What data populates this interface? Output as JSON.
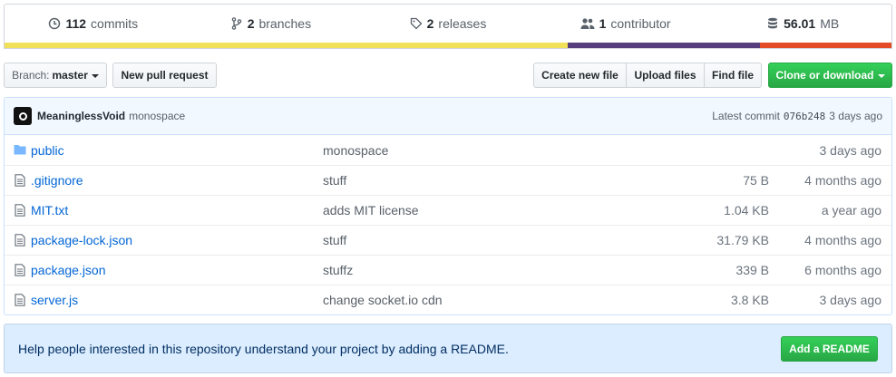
{
  "summary": {
    "commits": {
      "count": "112",
      "label": "commits",
      "icon": "history-icon"
    },
    "branches": {
      "count": "2",
      "label": "branches",
      "icon": "branch-icon"
    },
    "releases": {
      "count": "2",
      "label": "releases",
      "icon": "tag-icon"
    },
    "contributors": {
      "count": "1",
      "label": "contributor",
      "icon": "people-icon"
    },
    "size": {
      "count": "56.01",
      "label": "MB",
      "icon": "database-icon"
    },
    "languages": [
      {
        "color": "#f1e05a",
        "percent": 63.5
      },
      {
        "color": "#563d7c",
        "percent": 21.7
      },
      {
        "color": "#e34c26",
        "percent": 14.8
      }
    ]
  },
  "toolbar": {
    "branch_prefix": "Branch:",
    "branch_name": "master",
    "new_pull_request": "New pull request",
    "create_new_file": "Create new file",
    "upload_files": "Upload files",
    "find_file": "Find file",
    "clone_or_download": "Clone or download"
  },
  "commit": {
    "author": "MeaninglessVoid",
    "message": "monospace",
    "latest_label": "Latest commit",
    "sha": "076b248",
    "age": "3 days ago"
  },
  "files": [
    {
      "type": "folder",
      "name": "public",
      "message": "monospace",
      "size": "",
      "age": "3 days ago"
    },
    {
      "type": "file",
      "name": ".gitignore",
      "message": "stuff",
      "size": "75 B",
      "age": "4 months ago"
    },
    {
      "type": "file",
      "name": "MIT.txt",
      "message": "adds MIT license",
      "size": "1.04 KB",
      "age": "a year ago"
    },
    {
      "type": "file",
      "name": "package-lock.json",
      "message": "stuff",
      "size": "31.79 KB",
      "age": "4 months ago"
    },
    {
      "type": "file",
      "name": "package.json",
      "message": "stuffz",
      "size": "339 B",
      "age": "6 months ago"
    },
    {
      "type": "file",
      "name": "server.js",
      "message": "change socket.io cdn",
      "size": "3.8 KB",
      "age": "3 days ago"
    }
  ],
  "readme": {
    "text": "Help people interested in this repository understand your project by adding a README.",
    "button": "Add a README"
  }
}
